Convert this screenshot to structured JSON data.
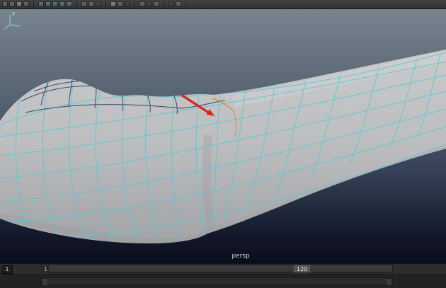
{
  "app": {
    "name": "Maya 3D viewport"
  },
  "toolbar": {
    "groups": [
      {
        "icons": [
          {
            "name": "selection-mask-icon",
            "tone": "mid"
          },
          {
            "name": "hierarchy-mode-icon",
            "tone": "mid"
          },
          {
            "name": "object-mode-icon",
            "tone": "light"
          },
          {
            "name": "component-mode-icon",
            "tone": "mid"
          }
        ]
      },
      {
        "icons": [
          {
            "name": "snap-grid-icon",
            "tone": "teal"
          },
          {
            "name": "snap-curve-icon",
            "tone": "teal"
          },
          {
            "name": "snap-point-icon",
            "tone": "teal"
          },
          {
            "name": "snap-plane-icon",
            "tone": "teal"
          },
          {
            "name": "snap-view-icon",
            "tone": "teal"
          }
        ]
      },
      {
        "icons": [
          {
            "name": "input-connections-icon",
            "tone": "mid"
          },
          {
            "name": "output-connections-icon",
            "tone": "mid"
          },
          {
            "name": "construction-history-icon",
            "tone": "dark"
          }
        ]
      },
      {
        "icons": [
          {
            "name": "render-frame-icon",
            "tone": "light"
          },
          {
            "name": "ipr-render-icon",
            "tone": "mid"
          },
          {
            "name": "render-settings-icon",
            "tone": "dark"
          }
        ]
      },
      {
        "icons": [
          {
            "name": "paint-effects-icon",
            "tone": "mid"
          },
          {
            "name": "toolbox-icon",
            "tone": "dark"
          },
          {
            "name": "symmetry-icon",
            "tone": "mid"
          }
        ]
      },
      {
        "icons": [
          {
            "name": "field-entry-icon",
            "tone": "dark"
          },
          {
            "name": "absolute-transform-icon",
            "tone": "mid"
          }
        ]
      }
    ]
  },
  "viewport": {
    "camera_label": "persp",
    "axis_gizmo": {
      "up_label": "y"
    },
    "colors": {
      "background_top": "#78848e",
      "background_bottom": "#0a0d1a",
      "mesh_fill": "#bcbdbf",
      "wire_selected": "#5bc8d4",
      "wire_back": "#2c3a5e",
      "edge_highlight": "#d08e2e",
      "annotation_arrow": "#e02319"
    }
  },
  "timeline": {
    "current_frame": "1",
    "tick_start": "1",
    "range_end": "120"
  }
}
